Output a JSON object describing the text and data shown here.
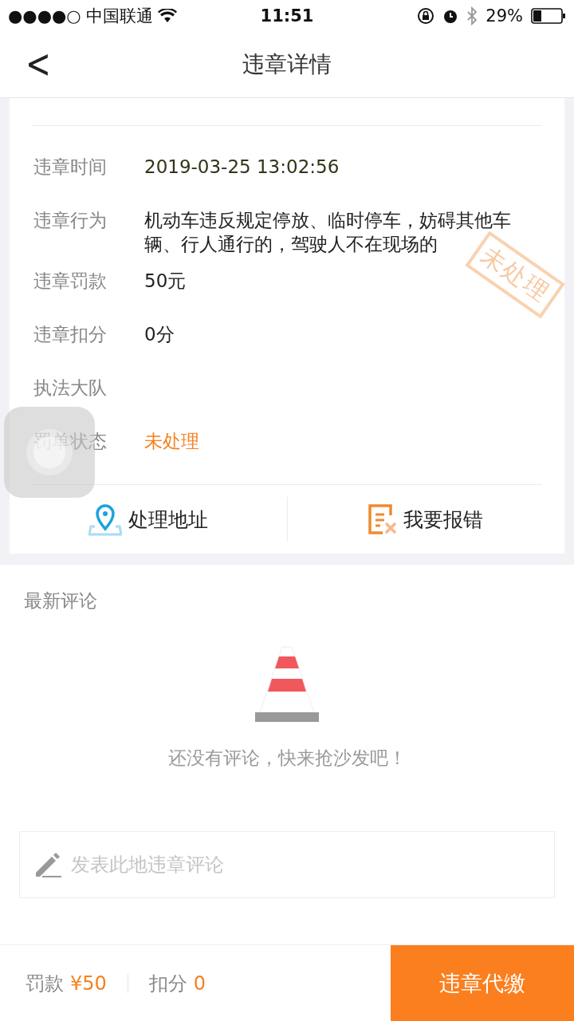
{
  "status_bar": {
    "signal": "●●●●○",
    "carrier": "中国联通",
    "time": "11:51",
    "battery": "29%"
  },
  "nav": {
    "back": "<",
    "title": "违章详情"
  },
  "details": [
    {
      "label": "违章时间",
      "value": "2019-03-25 13:02:56",
      "kind": "time"
    },
    {
      "label": "违章行为",
      "value": "机动车违反规定停放、临时停车，妨碍其他车辆、行人通行的，驾驶人不在现场的",
      "kind": "text"
    },
    {
      "label": "违章罚款",
      "value": "50元",
      "kind": "text"
    },
    {
      "label": "违章扣分",
      "value": "0分",
      "kind": "text"
    },
    {
      "label": "执法大队",
      "kind": "text"
    },
    {
      "label": "罚单状态",
      "value": "未处理",
      "kind": "status"
    }
  ],
  "stamp": "未处理",
  "actions": [
    {
      "label": "处理地址",
      "kind": "location"
    },
    {
      "label": "我要报错",
      "kind": "report"
    }
  ],
  "comments": {
    "title": "最新评论",
    "empty": "还没有评论，快来抢沙发吧！",
    "placeholder": "发表此地违章评论"
  },
  "footer": {
    "fine_label": "罚款",
    "fine": "¥50",
    "points_label": "扣分",
    "points": "0",
    "pay_button": "违章代缴"
  }
}
